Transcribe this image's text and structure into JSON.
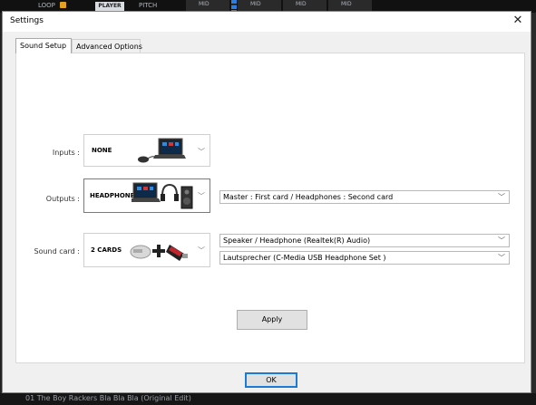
{
  "background": {
    "loop_label": "LOOP",
    "player_label": "PLAYER",
    "pitch_label": "PITCH",
    "mid_labels": [
      "MID",
      "MID",
      "MID",
      "MID"
    ],
    "track_title": "01 The Boy Rackers Bla Bla Bla (Original Edit)"
  },
  "dialog": {
    "title": "Settings",
    "close_glyph": "✕",
    "tabs": [
      {
        "label": "Sound Setup",
        "active": true
      },
      {
        "label": "Advanced Options",
        "active": false
      }
    ],
    "inputs": {
      "label": "Inputs :",
      "value": "NONE"
    },
    "outputs": {
      "label": "Outputs :",
      "value": "HEADPHONES",
      "mode": "Master : First card / Headphones : Second card"
    },
    "sound_card": {
      "label": "Sound card :",
      "value": "2 CARDS",
      "card1": "Speaker / Headphone (Realtek(R) Audio)",
      "card2": "Lautsprecher (C-Media USB Headphone Set  )"
    },
    "apply_label": "Apply",
    "ok_label": "OK"
  }
}
